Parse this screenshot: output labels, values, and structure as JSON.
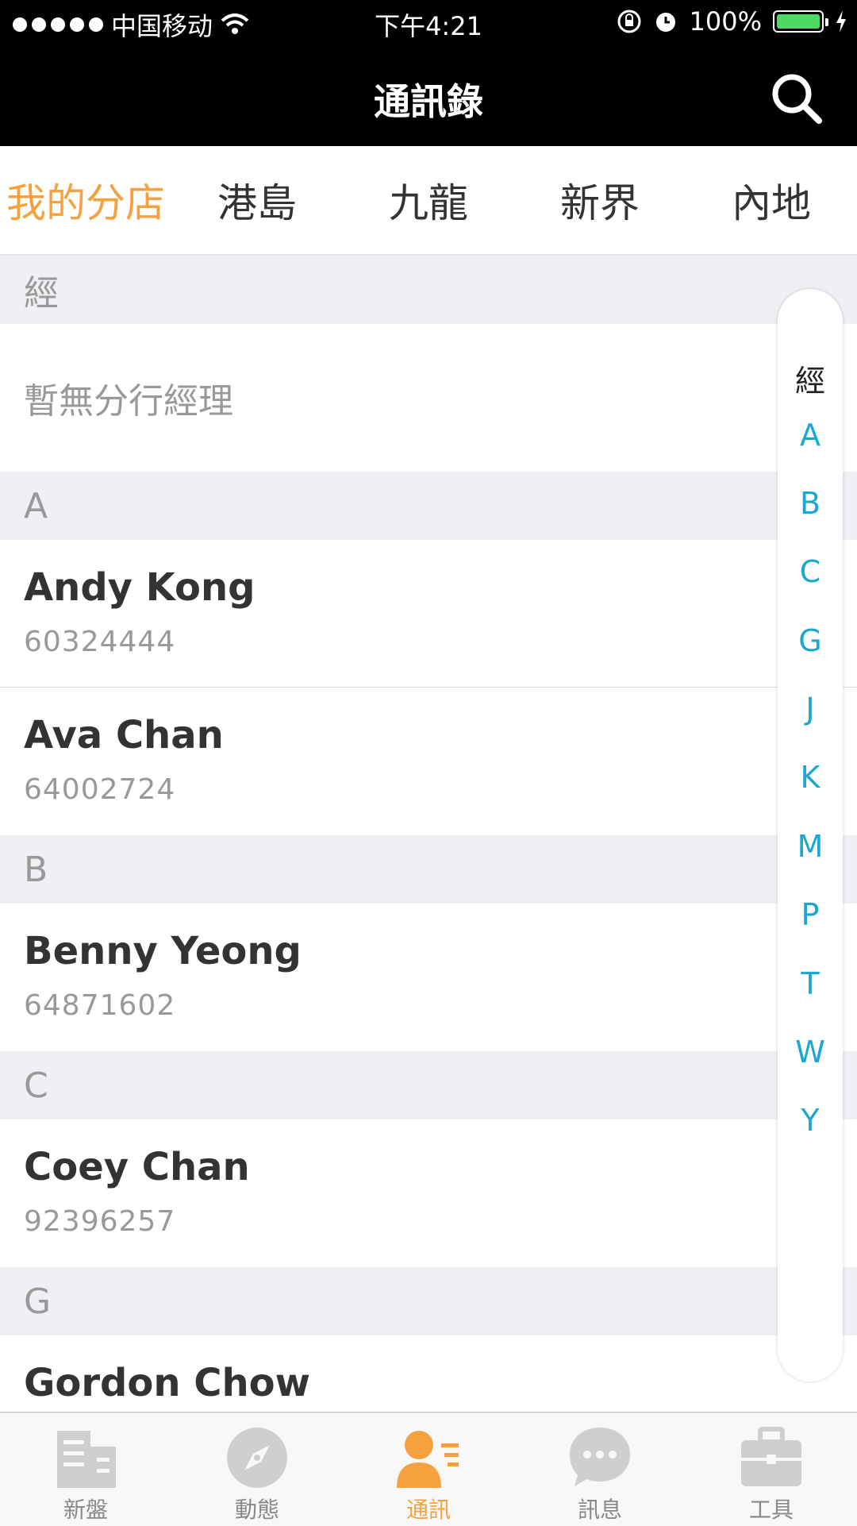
{
  "status_bar": {
    "carrier": "中国移动",
    "time": "下午4:21",
    "battery_percent": "100%",
    "battery_level": 1.0
  },
  "nav": {
    "title": "通訊錄",
    "search_icon": "search-icon"
  },
  "tabs": [
    {
      "label": "我的分店",
      "active": true
    },
    {
      "label": "港島",
      "active": false
    },
    {
      "label": "九龍",
      "active": false
    },
    {
      "label": "新界",
      "active": false
    },
    {
      "label": "內地",
      "active": false
    }
  ],
  "list": {
    "manager_header": "經",
    "manager_empty": "暫無分行經理",
    "sections": [
      {
        "letter": "A",
        "contacts": [
          {
            "name": "Andy Kong",
            "phone": "60324444"
          },
          {
            "name": "Ava Chan",
            "phone": "64002724"
          }
        ]
      },
      {
        "letter": "B",
        "contacts": [
          {
            "name": "Benny Yeong",
            "phone": "64871602"
          }
        ]
      },
      {
        "letter": "C",
        "contacts": [
          {
            "name": "Coey Chan",
            "phone": "92396257"
          }
        ]
      },
      {
        "letter": "G",
        "contacts": [
          {
            "name": "Gordon Chow",
            "phone": ""
          }
        ]
      }
    ]
  },
  "index": [
    "經",
    "A",
    "B",
    "C",
    "G",
    "J",
    "K",
    "M",
    "P",
    "T",
    "W",
    "Y"
  ],
  "tab_bar": [
    {
      "label": "新盤",
      "icon": "building-icon",
      "active": false
    },
    {
      "label": "動態",
      "icon": "compass-icon",
      "active": false
    },
    {
      "label": "通訊",
      "icon": "contacts-icon",
      "active": true
    },
    {
      "label": "訊息",
      "icon": "chat-bubble-icon",
      "active": false
    },
    {
      "label": "工具",
      "icon": "toolbox-icon",
      "active": false
    }
  ],
  "colors": {
    "accent": "#f7a13e",
    "index_letter": "#1aa7d4",
    "section_bg": "#efeff4"
  }
}
